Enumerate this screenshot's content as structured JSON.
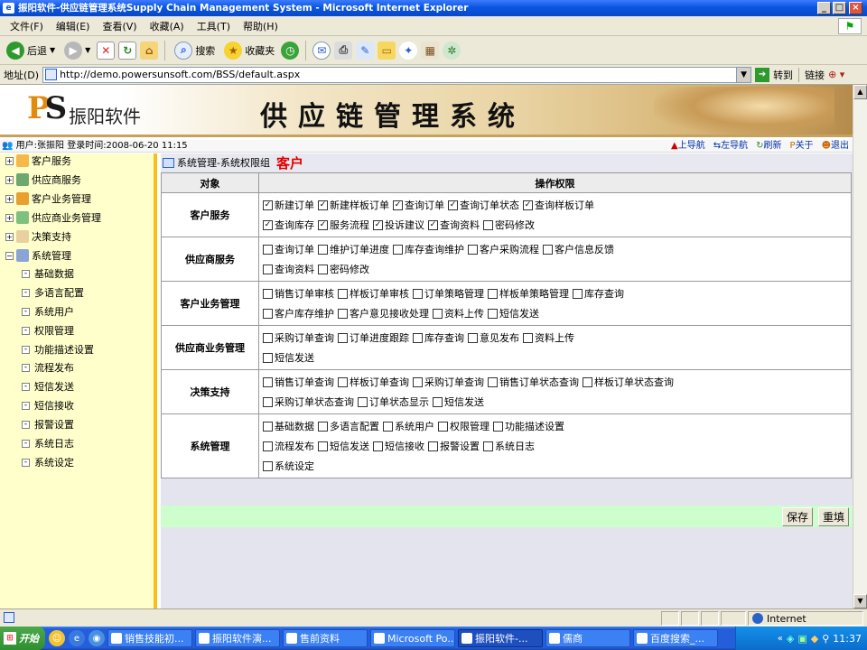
{
  "window": {
    "title": "振阳软件-供应链管理系统Supply Chain Management System - Microsoft Internet Explorer",
    "min": "_",
    "max": "□",
    "close": "×"
  },
  "menu": [
    "文件(F)",
    "编辑(E)",
    "查看(V)",
    "收藏(A)",
    "工具(T)",
    "帮助(H)"
  ],
  "toolbar": {
    "back": "后退",
    "search": "搜索",
    "favorites": "收藏夹"
  },
  "address": {
    "label": "地址(D)",
    "url": "http://demo.powersunsoft.com/BSS/default.aspx",
    "go": "转到",
    "links": "链接"
  },
  "banner": {
    "brand": "振阳软件",
    "system_title": "供应链管理系统"
  },
  "infobar": {
    "user_text": "用户:张振阳  登录时间:2008-06-20 11:15",
    "nav": [
      "上导航",
      "左导航",
      "刷新",
      "关于",
      "退出"
    ]
  },
  "sidebar": {
    "top_items": [
      "客户服务",
      "供应商服务",
      "客户业务管理",
      "供应商业务管理",
      "决策支持",
      "系统管理"
    ],
    "sub_items": [
      "基础数据",
      "多语言配置",
      "系统用户",
      "权限管理",
      "功能描述设置",
      "流程发布",
      "短信发送",
      "短信接收",
      "报警设置",
      "系统日志",
      "系统设定"
    ]
  },
  "breadcrumb": {
    "path": "系统管理-系统权限组",
    "role": "客户"
  },
  "table": {
    "headers": [
      "对象",
      "操作权限"
    ],
    "groups": [
      {
        "object": "客户服务",
        "rows": [
          [
            {
              "label": "新建订单",
              "checked": true
            },
            {
              "label": "新建样板订单",
              "checked": true
            },
            {
              "label": "查询订单",
              "checked": true
            },
            {
              "label": "查询订单状态",
              "checked": true
            },
            {
              "label": "查询样板订单",
              "checked": true
            }
          ],
          [
            {
              "label": "查询库存",
              "checked": true
            },
            {
              "label": "服务流程",
              "checked": true
            },
            {
              "label": "投诉建议",
              "checked": true
            },
            {
              "label": "查询资料",
              "checked": true
            },
            {
              "label": "密码修改",
              "checked": false
            }
          ]
        ]
      },
      {
        "object": "供应商服务",
        "rows": [
          [
            {
              "label": "查询订单",
              "checked": false
            },
            {
              "label": "维护订单进度",
              "checked": false
            },
            {
              "label": "库存查询维护",
              "checked": false
            },
            {
              "label": "客户采购流程",
              "checked": false
            },
            {
              "label": "客户信息反馈",
              "checked": false
            }
          ],
          [
            {
              "label": "查询资料",
              "checked": false
            },
            {
              "label": "密码修改",
              "checked": false
            }
          ]
        ]
      },
      {
        "object": "客户业务管理",
        "rows": [
          [
            {
              "label": "销售订单审核",
              "checked": false
            },
            {
              "label": "样板订单审核",
              "checked": false
            },
            {
              "label": "订单策略管理",
              "checked": false
            },
            {
              "label": "样板单策略管理",
              "checked": false
            },
            {
              "label": "库存查询",
              "checked": false
            }
          ],
          [
            {
              "label": "客户库存维护",
              "checked": false
            },
            {
              "label": "客户意见接收处理",
              "checked": false
            },
            {
              "label": "资料上传",
              "checked": false
            },
            {
              "label": "短信发送",
              "checked": false
            }
          ]
        ]
      },
      {
        "object": "供应商业务管理",
        "rows": [
          [
            {
              "label": "采购订单查询",
              "checked": false
            },
            {
              "label": "订单进度跟踪",
              "checked": false
            },
            {
              "label": "库存查询",
              "checked": false
            },
            {
              "label": "意见发布",
              "checked": false
            },
            {
              "label": "资料上传",
              "checked": false
            }
          ],
          [
            {
              "label": "短信发送",
              "checked": false
            }
          ]
        ]
      },
      {
        "object": "决策支持",
        "rows": [
          [
            {
              "label": "销售订单查询",
              "checked": false
            },
            {
              "label": "样板订单查询",
              "checked": false
            },
            {
              "label": "采购订单查询",
              "checked": false
            },
            {
              "label": "销售订单状态查询",
              "checked": false
            },
            {
              "label": "样板订单状态查询",
              "checked": false
            }
          ],
          [
            {
              "label": "采购订单状态查询",
              "checked": false
            },
            {
              "label": "订单状态显示",
              "checked": false
            },
            {
              "label": "短信发送",
              "checked": false
            }
          ]
        ]
      },
      {
        "object": "系统管理",
        "rows": [
          [
            {
              "label": "基础数据",
              "checked": false
            },
            {
              "label": "多语言配置",
              "checked": false
            },
            {
              "label": "系统用户",
              "checked": false
            },
            {
              "label": "权限管理",
              "checked": false
            },
            {
              "label": "功能描述设置",
              "checked": false
            }
          ],
          [
            {
              "label": "流程发布",
              "checked": false
            },
            {
              "label": "短信发送",
              "checked": false
            },
            {
              "label": "短信接收",
              "checked": false
            },
            {
              "label": "报警设置",
              "checked": false
            },
            {
              "label": "系统日志",
              "checked": false
            }
          ],
          [
            {
              "label": "系统设定",
              "checked": false
            }
          ]
        ]
      }
    ]
  },
  "actions": {
    "save": "保存",
    "reset": "重填"
  },
  "status": {
    "zone": "Internet"
  },
  "taskbar": {
    "start": "开始",
    "tasks": [
      "销售技能初...",
      "振阳软件演...",
      "售前资料",
      "Microsoft Po...",
      "振阳软件-...",
      "儒商",
      "百度搜索_..."
    ],
    "active_task_index": 4,
    "clock": "11:37"
  }
}
